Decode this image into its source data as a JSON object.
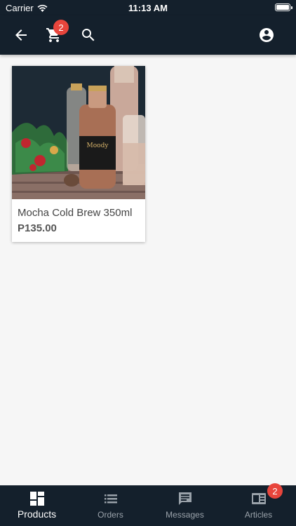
{
  "status_bar": {
    "carrier": "Carrier",
    "time": "11:13 AM"
  },
  "app_bar": {
    "cart_badge": "2"
  },
  "products": [
    {
      "name": "Mocha Cold Brew 350ml",
      "price": "P135.00",
      "image_label": "Moody"
    }
  ],
  "bottom_nav": {
    "items": [
      {
        "label": "Products",
        "icon": "dashboard-icon"
      },
      {
        "label": "Orders",
        "icon": "list-icon"
      },
      {
        "label": "Messages",
        "icon": "chat-icon"
      },
      {
        "label": "Articles",
        "icon": "article-icon"
      }
    ],
    "articles_badge": "2"
  },
  "colors": {
    "bar": "#14202c",
    "badge": "#e8453c"
  }
}
